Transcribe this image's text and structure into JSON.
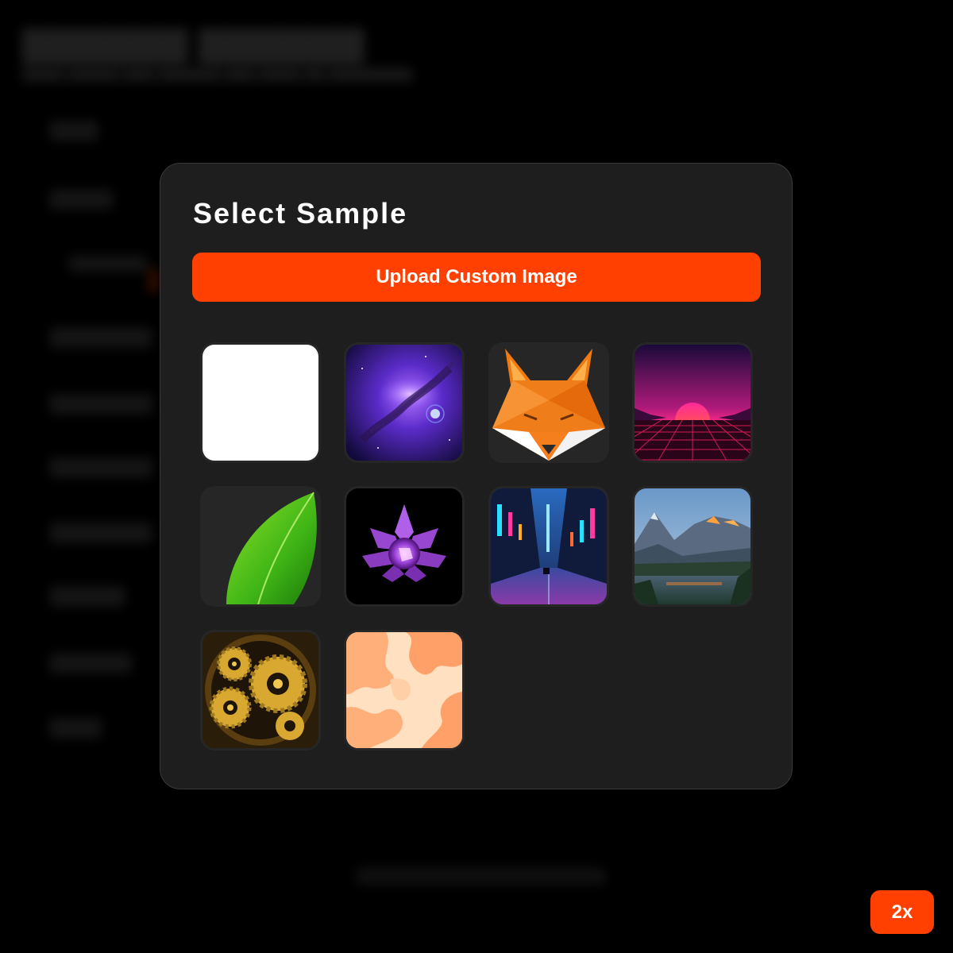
{
  "modal": {
    "title": "Select Sample",
    "upload_label": "Upload Custom Image",
    "samples": [
      {
        "name": "blank-white"
      },
      {
        "name": "purple-nebula"
      },
      {
        "name": "low-poly-fox"
      },
      {
        "name": "synthwave-sunset"
      },
      {
        "name": "green-leaf"
      },
      {
        "name": "purple-crystal-flower"
      },
      {
        "name": "neon-city-street"
      },
      {
        "name": "mountain-lake"
      },
      {
        "name": "golden-clockwork-gears"
      },
      {
        "name": "orange-abstract-pattern"
      }
    ]
  },
  "zoom": {
    "label": "2x"
  },
  "colors": {
    "accent": "#ff4000",
    "modal_bg": "#1e1e1e",
    "page_bg": "#000000"
  }
}
